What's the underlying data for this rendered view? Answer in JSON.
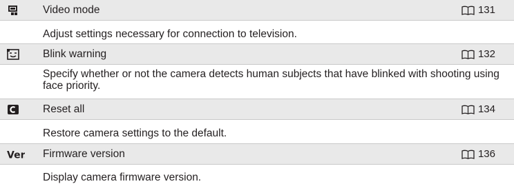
{
  "entries": [
    {
      "icon": "video-mode-icon",
      "title": "Video mode",
      "page": "131",
      "description": "Adjust settings necessary for connection to television."
    },
    {
      "icon": "blink-warning-icon",
      "title": "Blink warning",
      "page": "132",
      "description": "Specify whether or not the camera detects human subjects that have blinked with shooting using face priority."
    },
    {
      "icon": "reset-all-icon",
      "title": "Reset all",
      "page": "134",
      "description": "Restore camera settings to the default."
    },
    {
      "icon": "firmware-version-icon",
      "icon_text": "Ver.",
      "title": "Firmware version",
      "page": "136",
      "description": "Display camera firmware version."
    }
  ],
  "colors": {
    "header_background": "#e9e9e9",
    "rule": "#c9c9c9",
    "text": "#231f20"
  }
}
